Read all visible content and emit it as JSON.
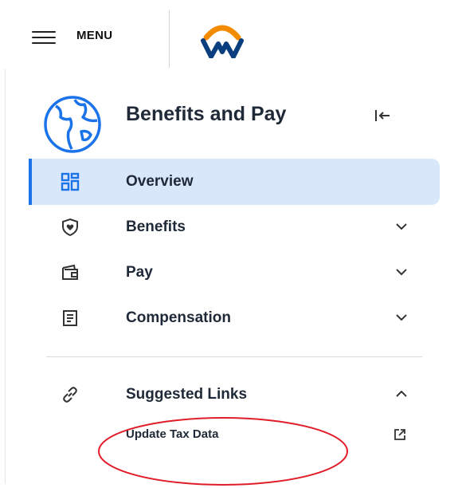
{
  "topbar": {
    "menu_label": "MENU",
    "brand_colors": {
      "arc": "#f38b00",
      "letter": "#0a3e7e"
    }
  },
  "header": {
    "title": "Benefits and Pay",
    "globe_icon": "globe-icon",
    "collapse_icon": "collapse-sidebar-icon"
  },
  "nav": {
    "items": [
      {
        "label": "Overview",
        "icon": "dashboard-grid-icon",
        "active": true,
        "expandable": false
      },
      {
        "label": "Benefits",
        "icon": "shield-heart-icon",
        "active": false,
        "expandable": true
      },
      {
        "label": "Pay",
        "icon": "wallet-icon",
        "active": false,
        "expandable": true
      },
      {
        "label": "Compensation",
        "icon": "document-lines-icon",
        "active": false,
        "expandable": true
      }
    ]
  },
  "suggested": {
    "label": "Suggested Links",
    "icon": "link-icon",
    "expanded": true,
    "links": [
      {
        "label": "Update Tax Data",
        "icon": "external-link-icon"
      }
    ]
  },
  "colors": {
    "active_bg": "#d9e7fb",
    "active_accent": "#1a73e8",
    "globe": "#1a73e8",
    "annotation": "#e11d2a"
  }
}
